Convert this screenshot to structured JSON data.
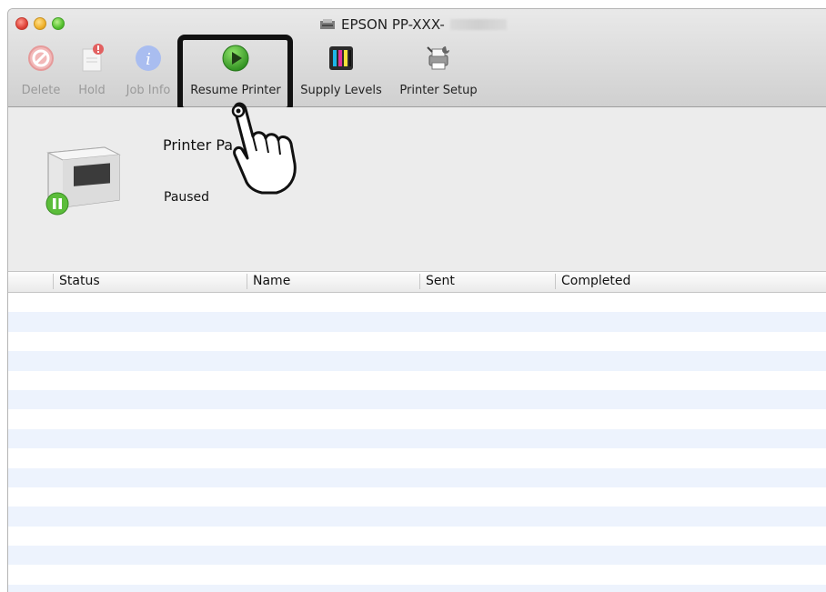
{
  "window": {
    "title_prefix": "EPSON PP-XXX-",
    "traffic_lights": [
      "close",
      "minimize",
      "zoom"
    ]
  },
  "toolbar": {
    "items": [
      {
        "label": "Delete",
        "icon": "delete-icon",
        "enabled": false
      },
      {
        "label": "Hold",
        "icon": "hold-icon",
        "enabled": false
      },
      {
        "label": "Job Info",
        "icon": "info-icon",
        "enabled": false
      },
      {
        "label": "Resume Printer",
        "icon": "play-icon",
        "enabled": true,
        "highlighted": true
      },
      {
        "label": "Supply Levels",
        "icon": "ink-levels-icon",
        "enabled": true
      },
      {
        "label": "Printer Setup",
        "icon": "printer-setup-icon",
        "enabled": true
      }
    ]
  },
  "printer": {
    "name": "Printer Pa",
    "state": "Paused"
  },
  "queue": {
    "columns": [
      "Status",
      "Name",
      "Sent",
      "Completed"
    ],
    "rows": []
  },
  "colors": {
    "accent_green": "#3fa82f",
    "row_stripe": "#edf3fd"
  }
}
